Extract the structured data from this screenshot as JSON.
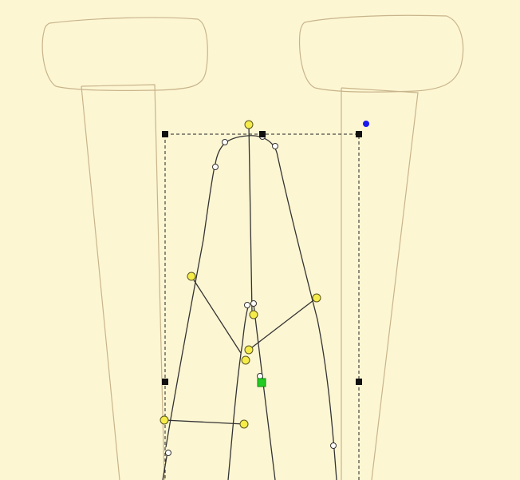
{
  "canvas": {
    "background": "#fdf6d3",
    "reference_outline_color": "#c8b48a",
    "skeleton_line_color": "#333333",
    "joint_handle_color": "#f5ec4a",
    "bezier_handle_color": "#ffffff",
    "selection_handle_color": "#111111",
    "center_pivot_color": "#22cc22",
    "rotate_handle_color": "#1a1aee"
  },
  "tool": {
    "mode": "skeleton-bone-edit",
    "selection": "bone-group"
  }
}
